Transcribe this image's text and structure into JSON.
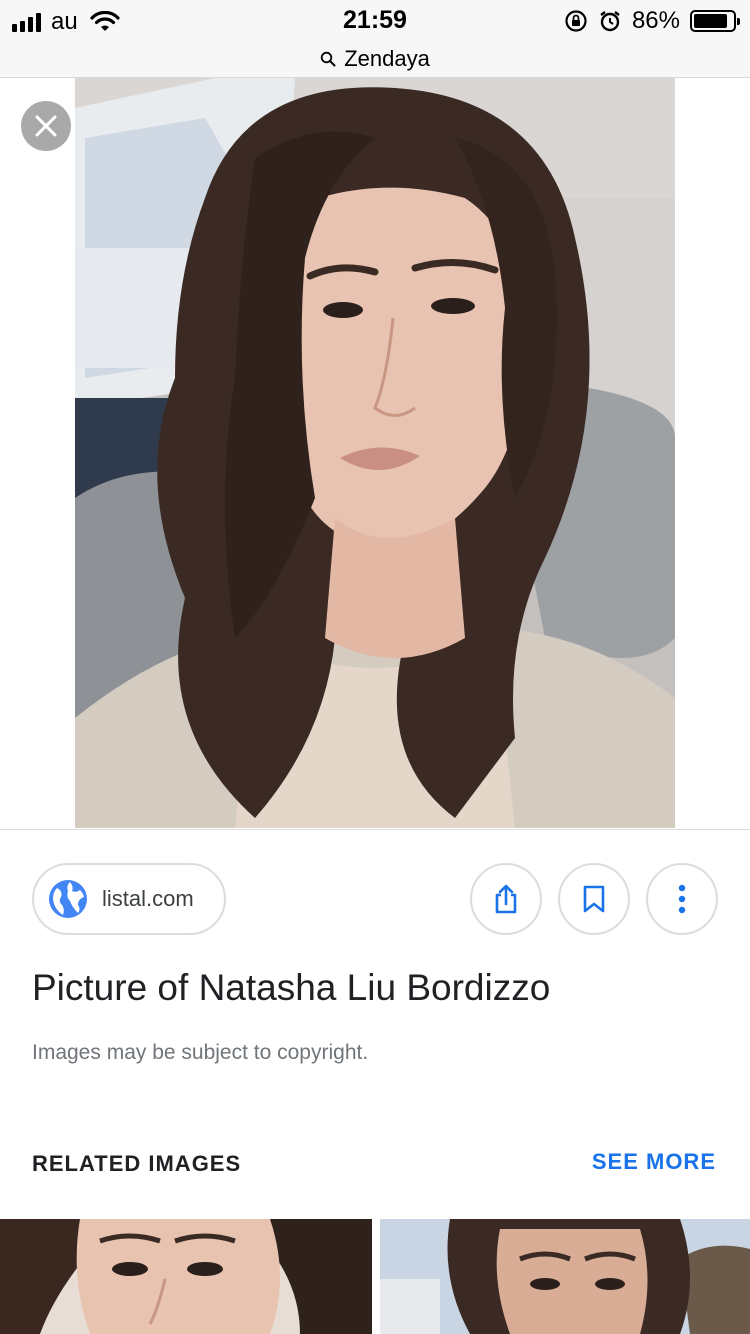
{
  "status_bar": {
    "carrier": "au",
    "time": "21:59",
    "battery_percent": "86%",
    "battery_level": 0.86,
    "icons": [
      "signal-icon",
      "wifi-icon",
      "rotation-lock-icon",
      "alarm-icon",
      "battery-icon"
    ]
  },
  "url_bar": {
    "query": "Zendaya",
    "icon": "search-icon"
  },
  "viewer": {
    "close_icon": "close-icon"
  },
  "info": {
    "source": "listal.com",
    "source_icon": "globe-icon",
    "actions": [
      "share-icon",
      "bookmark-icon",
      "more-vert-icon"
    ],
    "title": "Picture of Natasha Liu Bordizzo",
    "copyright_notice": "Images may be subject to copyright.",
    "related_label": "RELATED IMAGES",
    "see_more": "SEE MORE"
  },
  "colors": {
    "accent": "#1a73e8",
    "globe": "#4285f4",
    "chrome_bg": "#f7f7f7"
  }
}
